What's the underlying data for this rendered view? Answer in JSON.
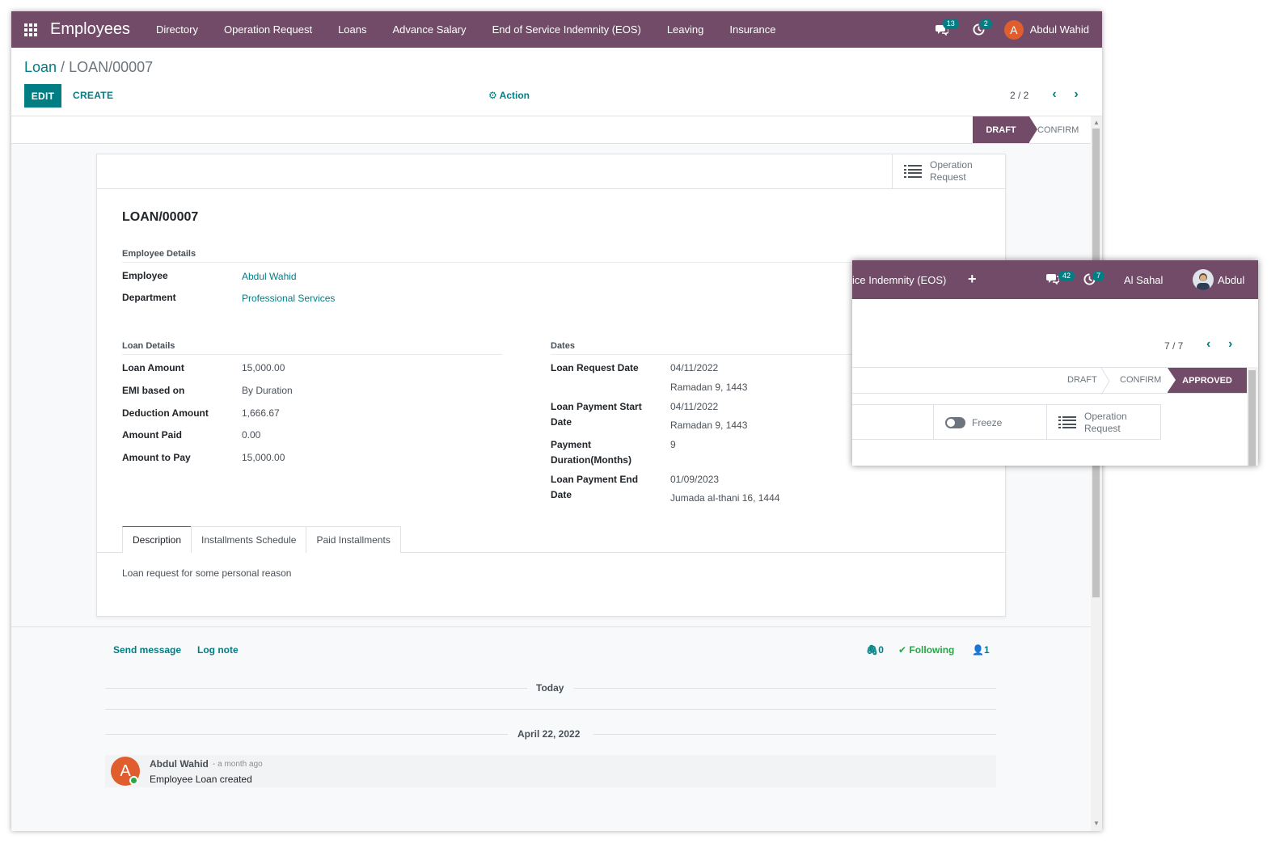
{
  "navbar": {
    "app_name": "Employees",
    "menu": [
      "Directory",
      "Operation Request",
      "Loans",
      "Advance Salary",
      "End of Service Indemnity (EOS)",
      "Leaving",
      "Insurance"
    ],
    "messages_count": "13",
    "activities_count": "2",
    "user_initial": "A",
    "user_name": "Abdul Wahid",
    "color": "#714B67"
  },
  "control_panel": {
    "breadcrumb_parent": "Loan",
    "breadcrumb_sep": " / ",
    "breadcrumb_current": "LOAN/00007",
    "edit_label": "EDIT",
    "create_label": "CREATE",
    "action_label": "Action",
    "pager": "2 / 2"
  },
  "status": {
    "draft": "DRAFT",
    "confirm": "CONFIRM"
  },
  "form": {
    "smart_button": "Operation Request",
    "title": "LOAN/00007",
    "employee_group": "Employee Details",
    "employee_label": "Employee",
    "employee_value": "Abdul Wahid",
    "department_label": "Department",
    "department_value": "Professional Services",
    "loan_group": "Loan Details",
    "loan_fields": [
      {
        "label": "Loan Amount",
        "value": "15,000.00"
      },
      {
        "label": "EMI based on",
        "value": "By Duration"
      },
      {
        "label": "Deduction Amount",
        "value": "1,666.67"
      },
      {
        "label": "Amount Paid",
        "value": "0.00"
      },
      {
        "label": "Amount to Pay",
        "value": "15,000.00"
      }
    ],
    "dates_group": "Dates",
    "request_date_label": "Loan Request Date",
    "request_date": "04/11/2022",
    "request_date_hijri": "Ramadan 9, 1443",
    "start_date_label_1": "Loan Payment Start",
    "start_date_label_2": "Date",
    "start_date": "04/11/2022",
    "start_date_hijri": "Ramadan 9, 1443",
    "duration_label_1": "Payment",
    "duration_label_2": "Duration(Months)",
    "duration": "9",
    "end_date_label_1": "Loan Payment End",
    "end_date_label_2": "Date",
    "end_date": "01/09/2023",
    "end_date_hijri": "Jumada al-thani 16, 1444",
    "tabs": [
      "Description",
      "Installments Schedule",
      "Paid Installments"
    ],
    "description": "Loan request for some personal reason"
  },
  "chatter": {
    "send_message": "Send message",
    "log_note": "Log note",
    "attachments": "0",
    "following": "Following",
    "followers": "1",
    "today": "Today",
    "date_sep": "April 22, 2022",
    "author_initial": "A",
    "author": "Abdul Wahid",
    "time": "- a month ago",
    "body": "Employee Loan created"
  },
  "overlay": {
    "menu_tail": "ice Indemnity (EOS)",
    "plus": "+",
    "messages_count": "42",
    "activities_count": "7",
    "company": "Al Sahal",
    "user_name": "Abdul",
    "pager": "7 / 7",
    "status_draft": "DRAFT",
    "status_confirm": "CONFIRM",
    "status_approved": "APPROVED",
    "freeze_label": "Freeze",
    "smart_button": "Operation Request"
  }
}
